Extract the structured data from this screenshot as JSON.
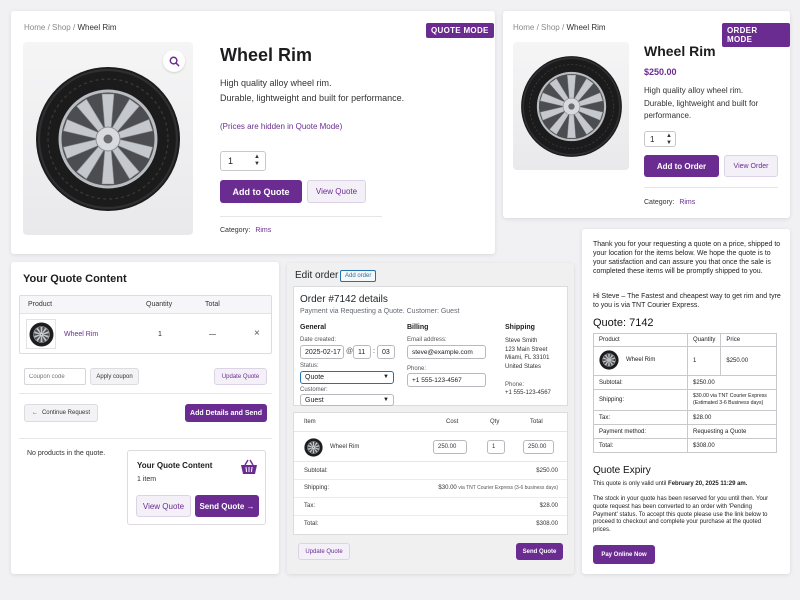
{
  "quote_product": {
    "breadcrumb": {
      "home": "Home",
      "shop": "Shop",
      "current": "Wheel Rim",
      "sep": "/"
    },
    "badge": "QUOTE MODE",
    "title": "Wheel Rim",
    "description_line1": "High quality alloy wheel rim.",
    "description_line2": "Durable, lightweight and built for performance.",
    "price_hidden_note": "(Prices are hidden in Quote Mode)",
    "quantity": "1",
    "add_to_quote_label": "Add to Quote",
    "view_quote_label": "View Quote",
    "category_label": "Category:",
    "category_value": "Rims"
  },
  "order_product": {
    "breadcrumb": {
      "home": "Home",
      "shop": "Shop",
      "current": "Wheel Rim",
      "sep": "/"
    },
    "badge": "ORDER MODE",
    "title": "Wheel Rim",
    "price": "$250.00",
    "description_line1": "High quality alloy wheel rim.",
    "description_line2": "Durable, lightweight and built for",
    "description_line3": "performance.",
    "quantity": "1",
    "add_to_order_label": "Add to Order",
    "view_order_label": "View Order",
    "category_label": "Category:",
    "category_value": "Rims"
  },
  "quote_content": {
    "title": "Your Quote Content",
    "headers": {
      "product": "Product",
      "quantity": "Quantity",
      "total": "Total"
    },
    "item": {
      "name": "Wheel Rim",
      "quantity": "1",
      "total": "—",
      "remove": "×"
    },
    "coupon_placeholder": "Coupon code",
    "apply_coupon_label": "Apply coupon",
    "update_quote_label": "Update Quote",
    "continue_label": "Continue Request",
    "add_details_label": "Add Details and Send",
    "empty_message": "No products in the quote.",
    "mini_title": "Your Quote Content",
    "mini_count": "1 item",
    "mini_view_label": "View Quote",
    "mini_send_label": "Send Quote →"
  },
  "edit_order": {
    "title": "Edit order",
    "add_order_label": "Add order",
    "order_title": "Order #7142 details",
    "payment_line": "Payment via Requesting a Quote. Customer: Guest",
    "general": {
      "heading": "General",
      "date_label": "Date created:",
      "date": "2025-02-17",
      "at": "@",
      "hour": "11",
      "minute": "03",
      "status_label": "Status:",
      "status": "Quote",
      "customer_label": "Customer:",
      "customer": "Guest"
    },
    "billing": {
      "heading": "Billing",
      "email_label": "Email address:",
      "email": "steve@example.com",
      "phone_label": "Phone:",
      "phone": "+1 555-123-4567"
    },
    "shipping": {
      "heading": "Shipping",
      "name": "Steve Smith",
      "street": "123 Main Street",
      "city": "Miami, FL 33101",
      "country": "United States",
      "phone_label": "Phone:",
      "phone": "+1 555-123-4567"
    },
    "items_headers": {
      "item": "Item",
      "cost": "Cost",
      "qty": "Qty",
      "total": "Total"
    },
    "item": {
      "name": "Wheel Rim",
      "cost": "250.00",
      "qty": "1",
      "total": "250.00"
    },
    "totals": {
      "subtotal_label": "Subtotal:",
      "subtotal": "$250.00",
      "shipping_label": "Shipping:",
      "shipping": "$30.00",
      "shipping_via": "via TNT Courier Express (3-6 business days)",
      "tax_label": "Tax:",
      "tax": "$28.00",
      "total_label": "Total:",
      "total": "$308.00"
    },
    "update_quote_label": "Update Quote",
    "send_quote_label": "Send Quote"
  },
  "email": {
    "intro": "Thank you for your requesting a quote on a price, shipped to your location for the items below. We hope the quote is to your satisfaction and can assure you that once the sale is completed these items will be promptly shipped to you.",
    "greeting": "Hi Steve – The Fastest and cheapest way to get rim and tyre to you is via TNT Courier Express.",
    "quote_title": "Quote: 7142",
    "headers": {
      "product": "Product",
      "quantity": "Quantity",
      "price": "Price"
    },
    "item": {
      "name": "Wheel Rim",
      "quantity": "1",
      "price": "$250.00"
    },
    "rows": {
      "subtotal_label": "Subtotal:",
      "subtotal": "$250.00",
      "shipping_label": "Shipping:",
      "shipping_line1": "$30.00 via TNT Courier Express",
      "shipping_line2": "(Estimated 3-6 Business days)",
      "tax_label": "Tax:",
      "tax": "$28.00",
      "payment_label": "Payment method:",
      "payment": "Requesting a Quote",
      "total_label": "Total:",
      "total": "$308.00"
    },
    "expiry_title": "Quote Expiry",
    "expiry_prefix": "This quote is only valid until",
    "expiry_date": "February 20, 2025 11:29 am.",
    "stock_note": "The stock in your quote has been reserved for you until then. Your quote request has been converted to an order with 'Pending Payment' status. To accept this quote please use the link below to proceed to checkout and complete your purchase at the quoted prices.",
    "pay_label": "Pay Online Now"
  },
  "colors": {
    "accent": "#6b2c91"
  }
}
